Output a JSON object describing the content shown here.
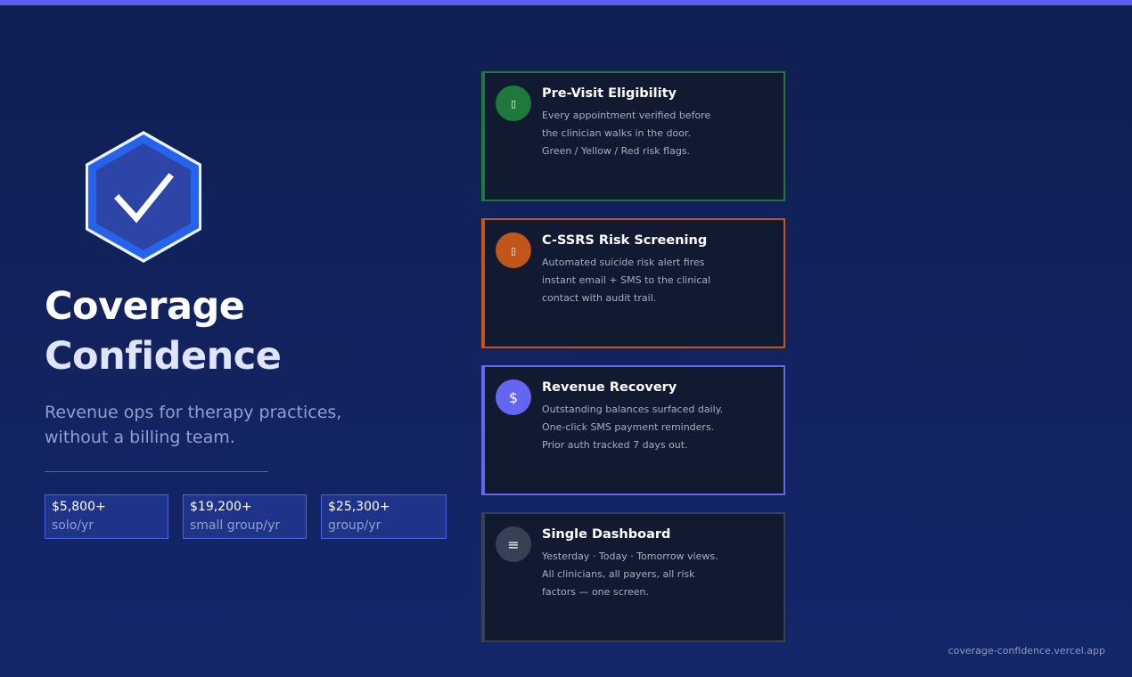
{
  "hero": {
    "title_line1": "Coverage",
    "title_line2": "Confidence",
    "subtitle_line1": "Revenue ops for therapy practices,",
    "subtitle_line2": "without a billing team."
  },
  "stats": [
    {
      "value": "$5,800+",
      "label": "solo/yr"
    },
    {
      "value": "$19,200+",
      "label": "small group/yr"
    },
    {
      "value": "$25,300+",
      "label": "group/yr"
    }
  ],
  "features": [
    {
      "title": "Pre-Visit Eligibility",
      "icon": "clipboard-icon",
      "icon_glyph": "▯",
      "accent": "#1e7a3a",
      "lines": [
        "Every appointment verified before",
        "the clinician walks in the door.",
        "Green / Yellow / Red risk flags."
      ]
    },
    {
      "title": "C-SSRS Risk Screening",
      "icon": "alert-icon",
      "icon_glyph": "▯",
      "accent": "#c2561a",
      "lines": [
        "Automated suicide risk alert fires",
        "instant email + SMS to the clinical",
        "contact with audit trail."
      ]
    },
    {
      "title": "Revenue Recovery",
      "icon": "dollar-icon",
      "icon_glyph": "$",
      "accent": "#6366f1",
      "lines": [
        "Outstanding balances surfaced daily.",
        "One-click SMS payment reminders.",
        "Prior auth tracked 7 days out."
      ]
    },
    {
      "title": "Single Dashboard",
      "icon": "menu-icon",
      "icon_glyph": "≡",
      "accent": "#374155",
      "lines": [
        "Yesterday · Today · Tomorrow views.",
        "All clinicians, all payers, all risk",
        "factors — one screen."
      ]
    }
  ],
  "footer": {
    "url": "coverage-confidence.vercel.app"
  },
  "colors": {
    "top_bar": "#5b5df0",
    "shield_blue": "#2563eb",
    "background": "#13266a"
  }
}
